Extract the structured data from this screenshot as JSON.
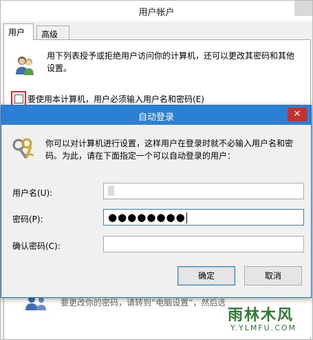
{
  "background_window": {
    "title": "用户帐户",
    "tabs": [
      {
        "label": "用户"
      },
      {
        "label": "高级"
      }
    ],
    "intro": "用下列表授予或拒绝用户访问你的计算机，还可以更改其密码和其他设置。",
    "require_checkbox_label": "要使用本计算机，用户必须输入用户名和密码(E)",
    "require_checkbox_checked": false,
    "bottom_text": "要更改你的密码，请转到“电脑设置”，然后选"
  },
  "dialog": {
    "title": "自动登录",
    "close_glyph": "✕",
    "description": "你可以对计算机进行设置，这样用户在登录时就不必输入用户名和密码。为此，请在下面指定一个可以自动登录的用户：",
    "fields": {
      "username_label": "用户名(U):",
      "username_value": "▒",
      "password_label": "密码(P):",
      "password_value": "●●●●●●●●",
      "confirm_label": "确认密码(C):",
      "confirm_value": ""
    },
    "buttons": {
      "ok": "确定",
      "cancel": "取消"
    }
  },
  "watermark": {
    "main": "雨林木风",
    "sub": "Y.YLMFU.COM"
  },
  "icons": {
    "users": "users-icon",
    "key": "key-icon"
  },
  "colors": {
    "dialog_title_bar": "#2b7fd4",
    "close_button": "#c7312b",
    "highlight_box": "#e1262d",
    "watermark": "#2d7a32"
  }
}
